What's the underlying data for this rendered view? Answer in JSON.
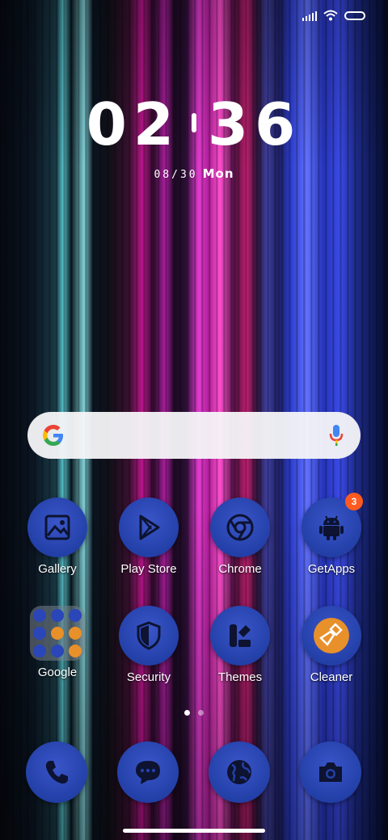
{
  "status": {
    "icons": [
      "signal-icon",
      "wifi-icon",
      "battery-icon"
    ]
  },
  "clock": {
    "hours": "02",
    "minutes": "36",
    "date": "08/30",
    "weekday": "Mon"
  },
  "search": {
    "icons": [
      "google-g-icon",
      "microphone-icon"
    ]
  },
  "apps_row1": [
    {
      "label": "Gallery",
      "icon": "gallery-icon"
    },
    {
      "label": "Play Store",
      "icon": "play-store-icon"
    },
    {
      "label": "Chrome",
      "icon": "chrome-icon"
    },
    {
      "label": "GetApps",
      "icon": "android-icon",
      "badge": "3"
    }
  ],
  "apps_row2": [
    {
      "label": "Google",
      "icon": "folder-icon"
    },
    {
      "label": "Security",
      "icon": "shield-icon"
    },
    {
      "label": "Themes",
      "icon": "themes-icon"
    },
    {
      "label": "Cleaner",
      "icon": "broom-icon"
    }
  ],
  "dock": [
    {
      "icon": "phone-icon"
    },
    {
      "icon": "messages-icon"
    },
    {
      "icon": "browser-globe-icon"
    },
    {
      "icon": "camera-icon"
    }
  ],
  "page_indicator": {
    "count": 2,
    "active": 1
  },
  "colors": {
    "icon_bg": "#2340a8",
    "badge": "#ff5a1f",
    "cleaner_accent": "#e8902a"
  }
}
